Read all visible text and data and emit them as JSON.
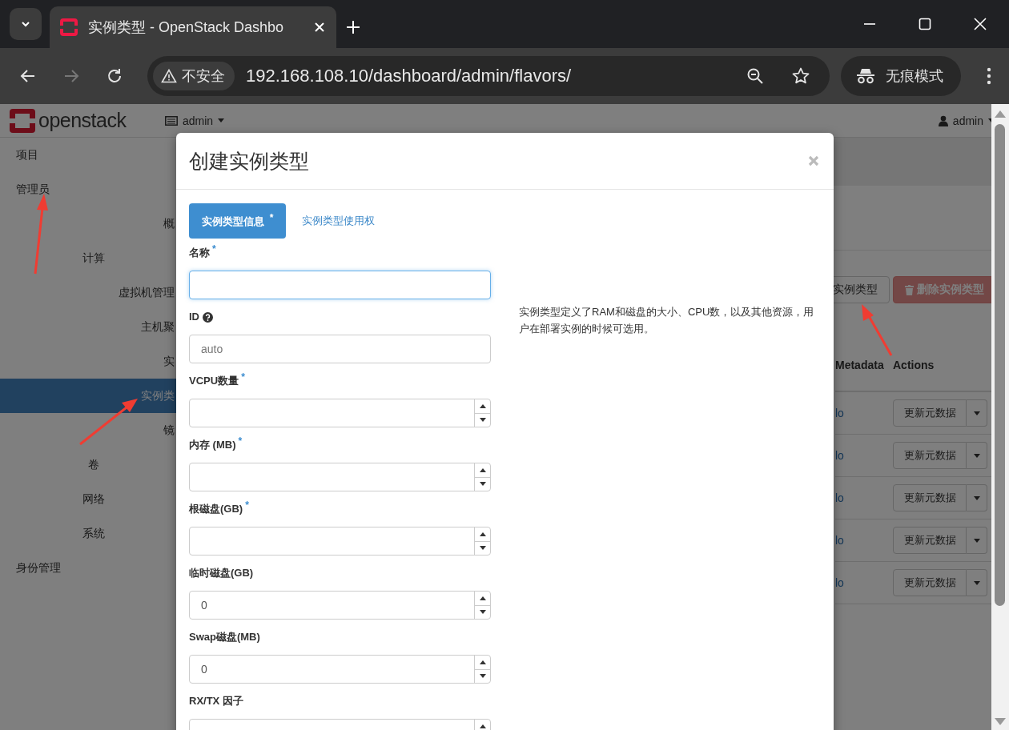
{
  "browser": {
    "tab": {
      "title": "实例类型 - OpenStack Dashbo",
      "selected": true
    },
    "security": "不安全",
    "url": "192.168.108.10/dashboard/admin/flavors/",
    "incognito": "无痕模式",
    "forward_disabled": true
  },
  "header": {
    "logo": "openstack",
    "project": "admin",
    "user": "admin"
  },
  "sidebar": [
    {
      "label": "项目",
      "kind": "dashboard",
      "selected": false
    },
    {
      "label": "管理员",
      "kind": "dashboard",
      "selected": false,
      "children": [
        {
          "label": "概",
          "kind": "panel",
          "selected": false
        },
        {
          "label": "计算",
          "kind": "group",
          "selected": false,
          "children": [
            {
              "label": "虚拟机管理",
              "kind": "panel",
              "selected": false
            },
            {
              "label": "主机聚",
              "kind": "panel",
              "selected": false
            },
            {
              "label": "实",
              "kind": "panel",
              "selected": false
            },
            {
              "label": "实例类",
              "kind": "panel",
              "selected": true
            },
            {
              "label": "镜",
              "kind": "panel",
              "selected": false
            }
          ]
        },
        {
          "label": "卷",
          "kind": "group",
          "selected": false
        },
        {
          "label": "网络",
          "kind": "group",
          "selected": false
        },
        {
          "label": "系统",
          "kind": "group",
          "selected": false
        }
      ]
    },
    {
      "label": "身份管理",
      "kind": "dashboard",
      "selected": false
    }
  ],
  "toolbar": [
    {
      "label": "实例类型",
      "kind": "default"
    },
    {
      "label": "删除实例类型",
      "kind": "danger"
    }
  ],
  "table": {
    "columns": [
      "Metadata",
      "Actions"
    ],
    "rows": [
      {
        "metadata": "lo",
        "action": "更新元数据"
      },
      {
        "metadata": "lo",
        "action": "更新元数据"
      },
      {
        "metadata": "lo",
        "action": "更新元数据"
      },
      {
        "metadata": "lo",
        "action": "更新元数据"
      },
      {
        "metadata": "lo",
        "action": "更新元数据"
      }
    ]
  },
  "modal": {
    "title": "创建实例类型",
    "required_mark": "*",
    "tabs": [
      {
        "label": "实例类型信息",
        "required": true,
        "selected": true
      },
      {
        "label": "实例类型使用权",
        "required": false,
        "selected": false
      }
    ],
    "fields": [
      {
        "label": "名称",
        "kind": "text",
        "required": true,
        "focused": true
      },
      {
        "label": "ID",
        "kind": "text",
        "required": false,
        "help": true,
        "focused": false,
        "placeholder": "auto"
      },
      {
        "label": "VCPU数量",
        "kind": "number",
        "required": true,
        "focused": false
      },
      {
        "label": "内存 (MB)",
        "kind": "number",
        "required": true,
        "focused": false
      },
      {
        "label": "根磁盘(GB)",
        "kind": "number",
        "required": true,
        "focused": false
      },
      {
        "label": "临时磁盘(GB)",
        "kind": "number",
        "required": false,
        "focused": false,
        "value": "0"
      },
      {
        "label": "Swap磁盘(MB)",
        "kind": "number",
        "required": false,
        "focused": false,
        "value": "0"
      },
      {
        "label": "RX/TX 因子",
        "kind": "number",
        "required": false,
        "focused": false
      }
    ],
    "description": "实例类型定义了RAM和磁盘的大小、CPU数，以及其他资源，用户在部署实例的时候可选用。"
  }
}
